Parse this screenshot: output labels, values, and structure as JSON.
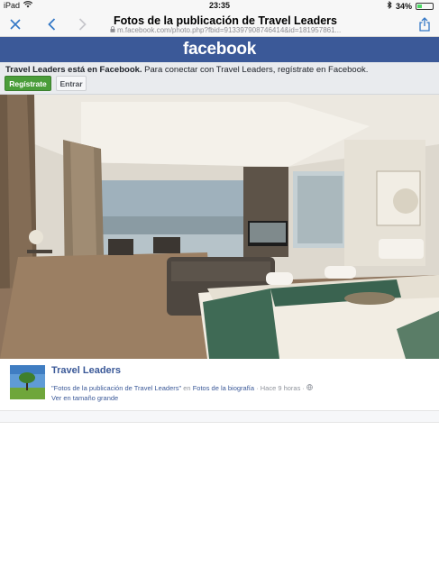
{
  "status": {
    "device": "iPad",
    "time": "23:35",
    "battery": "34%",
    "battery_level": 0.34
  },
  "nav": {
    "title": "Fotos de la publicación de Travel Leaders",
    "url": "m.facebook.com/photo.php?fbid=913397908746414&id=181957861..."
  },
  "fb": {
    "logo": "facebook"
  },
  "join": {
    "bold": "Travel Leaders está en Facebook.",
    "text": " Para conectar con Travel Leaders, regístrate en Facebook.",
    "register_label": "Regístrate",
    "login_label": "Entrar"
  },
  "post": {
    "page_name": "Travel Leaders",
    "album": "\"Fotos de la publicación de Travel Leaders\"",
    "in_word": " en ",
    "timeline": "Fotos de la biografía",
    "time": " · Hace 9 horas · ",
    "fullsize": "Ver en tamaño grande"
  }
}
